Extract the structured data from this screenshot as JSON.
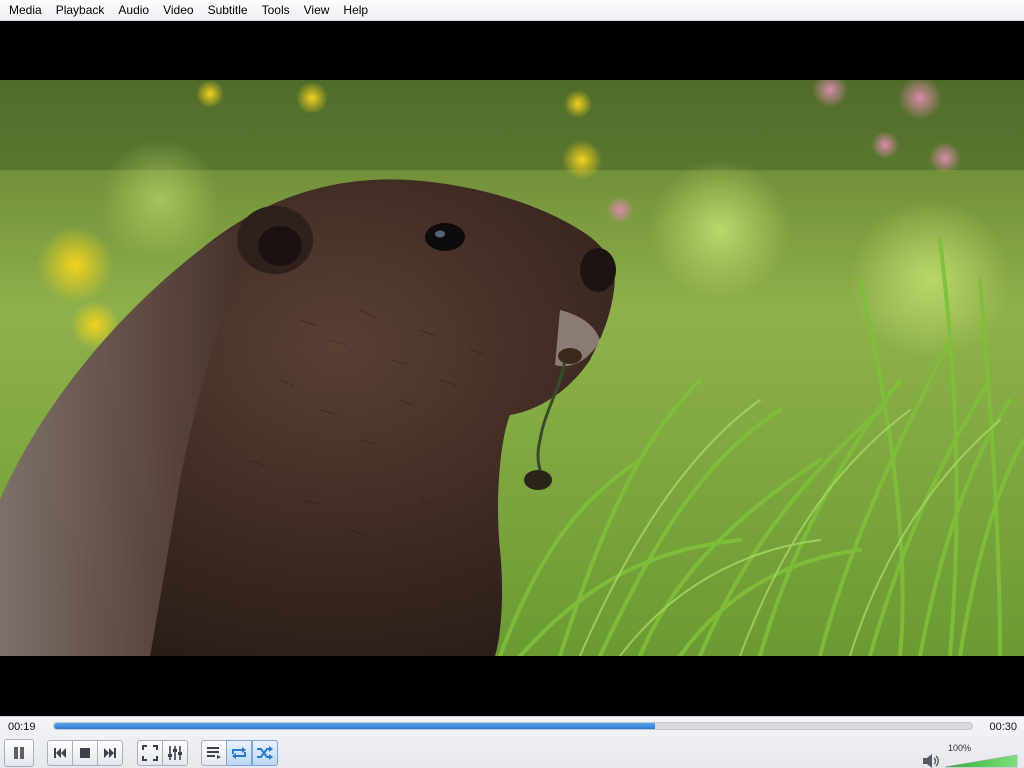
{
  "menu": {
    "items": [
      "Media",
      "Playback",
      "Audio",
      "Video",
      "Subtitle",
      "Tools",
      "View",
      "Help"
    ]
  },
  "video": {
    "content": "marmot-in-meadow-frame"
  },
  "playback": {
    "elapsed": "00:19",
    "total": "00:30",
    "progress_fraction": 0.655
  },
  "buttons": {
    "pause": "pause-icon",
    "prev": "skip-previous-icon",
    "stop": "stop-icon",
    "next": "skip-next-icon",
    "fullscreen": "fullscreen-icon",
    "extended": "equalizer-icon",
    "playlist": "playlist-icon",
    "loop": "loop-icon",
    "random": "shuffle-icon"
  },
  "volume": {
    "label": "100%",
    "level_fraction": 1.0,
    "icon": "speaker-icon"
  },
  "colors": {
    "accent": "#2a78cf",
    "volume_green": "#3fbf3f"
  }
}
